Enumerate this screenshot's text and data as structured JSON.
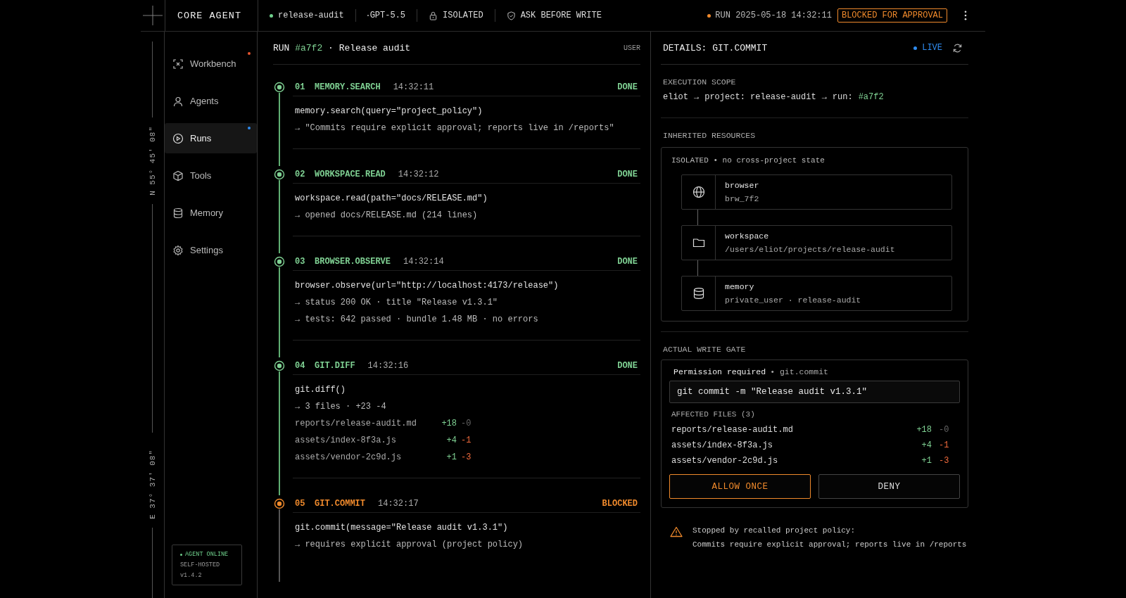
{
  "topbar": {
    "brand": "CORE AGENT",
    "project": "release-audit",
    "model": "GPT-5.5",
    "isolation": "ISOLATED",
    "write_policy": "ASK BEFORE WRITE",
    "run_stamp": "RUN 2025-05-18 14:32:11",
    "status_badge": "BLOCKED FOR APPROVAL"
  },
  "rail": {
    "coordinates": [
      "N 55° 45' 08\"",
      "E 37° 37' 08\""
    ]
  },
  "sidebar": {
    "items": [
      {
        "label": "Workbench",
        "selected": false,
        "color": "#e8552f"
      },
      {
        "label": "Agents",
        "selected": false
      },
      {
        "label": "Runs",
        "selected": true,
        "color": "#2f8cf0"
      },
      {
        "label": "Tools",
        "selected": false
      },
      {
        "label": "Memory",
        "selected": false
      },
      {
        "label": "Settings",
        "selected": false
      }
    ],
    "agent_status": {
      "status": "AGENT ONLINE",
      "mode": "SELF-HOSTED",
      "version": "v1.4.2"
    }
  },
  "run": {
    "prefix": "RUN",
    "run_id": "#a7f2",
    "name": "· Release audit",
    "user_label": "USER",
    "steps": [
      {
        "number": "01",
        "name": "MEMORY.SEARCH",
        "time": "14:32:11",
        "status": "DONE",
        "kind": "done",
        "lines": [
          "memory.search(query=\"project_policy\")",
          "→ \"Commits require explicit approval; reports live in /reports\""
        ]
      },
      {
        "number": "02",
        "name": "WORKSPACE.READ",
        "time": "14:32:12",
        "status": "DONE",
        "kind": "done",
        "lines": [
          "workspace.read(path=\"docs/RELEASE.md\")",
          "→ opened docs/RELEASE.md (214 lines)"
        ]
      },
      {
        "number": "03",
        "name": "BROWSER.OBSERVE",
        "time": "14:32:14",
        "status": "DONE",
        "kind": "done",
        "lines": [
          "browser.observe(url=\"http://localhost:4173/release\")",
          "→ status 200 OK · title \"Release v1.3.1\"",
          "→ tests: 642 passed · bundle 1.48 MB · no errors"
        ]
      },
      {
        "number": "04",
        "name": "GIT.DIFF",
        "time": "14:32:16",
        "status": "DONE",
        "kind": "done",
        "lines": [
          "git.diff()",
          "→ 3 files ·  +23 -4"
        ],
        "files": [
          {
            "path": "reports/release-audit.md",
            "added": "+18",
            "removed": "-0",
            "removed_none": true
          },
          {
            "path": "assets/index-8f3a.js",
            "added": "+4",
            "removed": "-1",
            "removed_none": false
          },
          {
            "path": "assets/vendor-2c9d.js",
            "added": "+1",
            "removed": "-3",
            "removed_none": false
          }
        ]
      },
      {
        "number": "05",
        "name": "GIT.COMMIT",
        "time": "14:32:17",
        "status": "BLOCKED",
        "kind": "blocked",
        "lines": [
          "git.commit(message=\"Release audit v1.3.1\")",
          "→ requires explicit approval (project policy)"
        ]
      }
    ]
  },
  "details": {
    "title": "DETAILS: GIT.COMMIT",
    "live": "LIVE",
    "scope": {
      "heading": "EXECUTION SCOPE",
      "crumbs": [
        "eliot",
        "→",
        "project: release-audit",
        "→",
        "run:"
      ],
      "run_id": "#a7f2"
    },
    "resources": {
      "heading": "INHERITED RESOURCES",
      "note": "ISOLATED • no cross-project state",
      "items": [
        {
          "name": "browser",
          "detail": "brw_7f2"
        },
        {
          "name": "workspace",
          "detail": "/users/eliot/projects/release-audit"
        },
        {
          "name": "memory",
          "detail": "private_user · release-audit"
        }
      ]
    },
    "gate": {
      "heading": "ACTUAL WRITE GATE",
      "permission": "Permission required",
      "permission_target": "• git.commit",
      "command": "git commit -m \"Release audit v1.3.1\"",
      "files_heading": "AFFECTED FILES (3)",
      "files": [
        {
          "path": "reports/release-audit.md",
          "added": "+18",
          "removed": "-0",
          "removed_none": true
        },
        {
          "path": "assets/index-8f3a.js",
          "added": "+4",
          "removed": "-1",
          "removed_none": false
        },
        {
          "path": "assets/vendor-2c9d.js",
          "added": "+1",
          "removed": "-3",
          "removed_none": false
        }
      ],
      "allow": "ALLOW ONCE",
      "deny": "DENY"
    },
    "warning": {
      "title": "Stopped by recalled project policy:",
      "text": "Commits require explicit approval; reports live in /reports"
    }
  }
}
